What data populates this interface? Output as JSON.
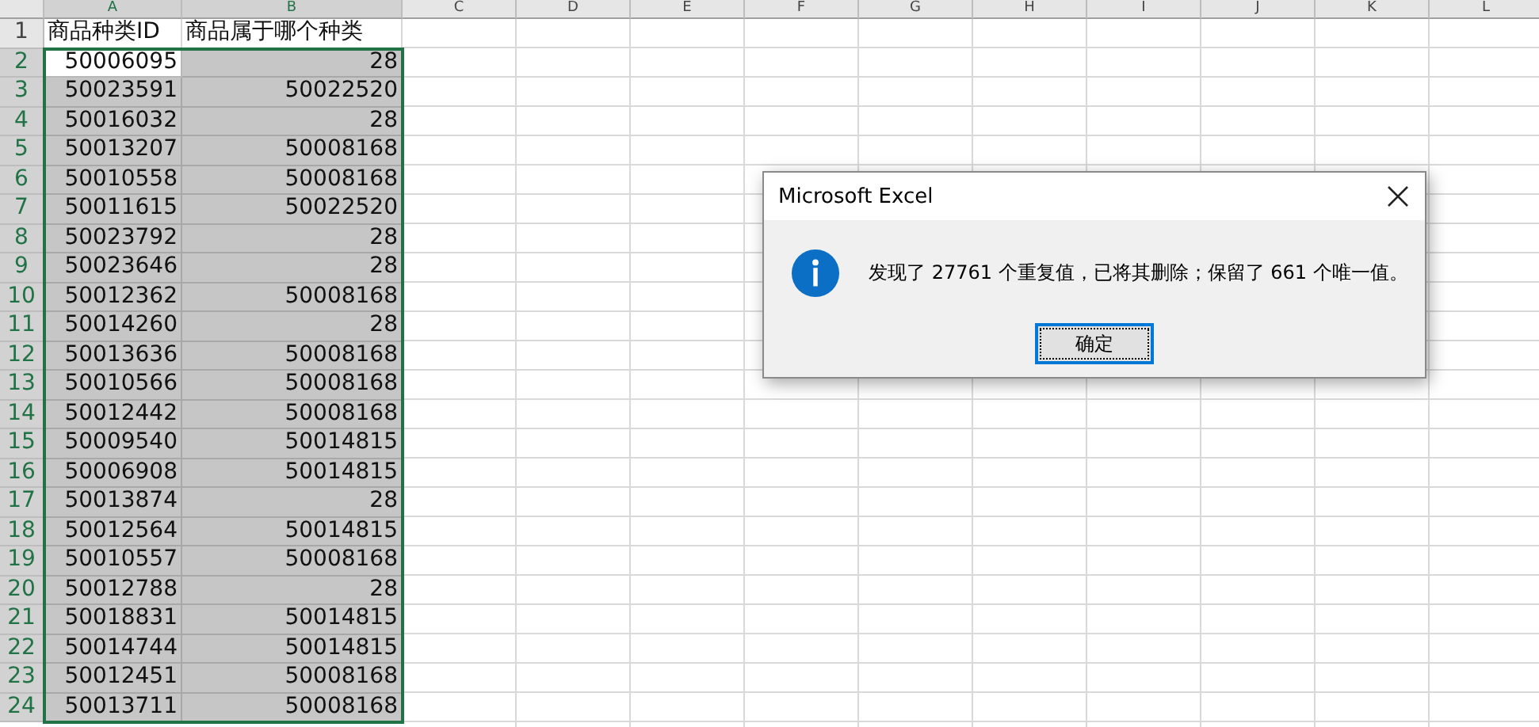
{
  "column_headers": [
    {
      "label": "A",
      "selected": true
    },
    {
      "label": "B",
      "selected": true
    },
    {
      "label": "C",
      "selected": false
    },
    {
      "label": "D",
      "selected": false
    },
    {
      "label": "E",
      "selected": false
    },
    {
      "label": "F",
      "selected": false
    },
    {
      "label": "G",
      "selected": false
    },
    {
      "label": "H",
      "selected": false
    },
    {
      "label": "I",
      "selected": false
    },
    {
      "label": "J",
      "selected": false
    },
    {
      "label": "K",
      "selected": false
    },
    {
      "label": "L",
      "selected": false
    }
  ],
  "rows": [
    {
      "number": "1",
      "kind": "header",
      "selected": false,
      "cells": [
        {
          "text": "商品种类ID",
          "selected": false,
          "active": false
        },
        {
          "text": "商品属于哪个种类",
          "selected": false,
          "active": false
        }
      ]
    },
    {
      "number": "2",
      "kind": "data",
      "selected": true,
      "cells": [
        {
          "text": "50006095",
          "selected": true,
          "active": true
        },
        {
          "text": "28",
          "selected": true,
          "active": false
        }
      ]
    },
    {
      "number": "3",
      "kind": "data",
      "selected": true,
      "cells": [
        {
          "text": "50023591",
          "selected": true,
          "active": false
        },
        {
          "text": "50022520",
          "selected": true,
          "active": false
        }
      ]
    },
    {
      "number": "4",
      "kind": "data",
      "selected": true,
      "cells": [
        {
          "text": "50016032",
          "selected": true,
          "active": false
        },
        {
          "text": "28",
          "selected": true,
          "active": false
        }
      ]
    },
    {
      "number": "5",
      "kind": "data",
      "selected": true,
      "cells": [
        {
          "text": "50013207",
          "selected": true,
          "active": false
        },
        {
          "text": "50008168",
          "selected": true,
          "active": false
        }
      ]
    },
    {
      "number": "6",
      "kind": "data",
      "selected": true,
      "cells": [
        {
          "text": "50010558",
          "selected": true,
          "active": false
        },
        {
          "text": "50008168",
          "selected": true,
          "active": false
        }
      ]
    },
    {
      "number": "7",
      "kind": "data",
      "selected": true,
      "cells": [
        {
          "text": "50011615",
          "selected": true,
          "active": false
        },
        {
          "text": "50022520",
          "selected": true,
          "active": false
        }
      ]
    },
    {
      "number": "8",
      "kind": "data",
      "selected": true,
      "cells": [
        {
          "text": "50023792",
          "selected": true,
          "active": false
        },
        {
          "text": "28",
          "selected": true,
          "active": false
        }
      ]
    },
    {
      "number": "9",
      "kind": "data",
      "selected": true,
      "cells": [
        {
          "text": "50023646",
          "selected": true,
          "active": false
        },
        {
          "text": "28",
          "selected": true,
          "active": false
        }
      ]
    },
    {
      "number": "10",
      "kind": "data",
      "selected": true,
      "cells": [
        {
          "text": "50012362",
          "selected": true,
          "active": false
        },
        {
          "text": "50008168",
          "selected": true,
          "active": false
        }
      ]
    },
    {
      "number": "11",
      "kind": "data",
      "selected": true,
      "cells": [
        {
          "text": "50014260",
          "selected": true,
          "active": false
        },
        {
          "text": "28",
          "selected": true,
          "active": false
        }
      ]
    },
    {
      "number": "12",
      "kind": "data",
      "selected": true,
      "cells": [
        {
          "text": "50013636",
          "selected": true,
          "active": false
        },
        {
          "text": "50008168",
          "selected": true,
          "active": false
        }
      ]
    },
    {
      "number": "13",
      "kind": "data",
      "selected": true,
      "cells": [
        {
          "text": "50010566",
          "selected": true,
          "active": false
        },
        {
          "text": "50008168",
          "selected": true,
          "active": false
        }
      ]
    },
    {
      "number": "14",
      "kind": "data",
      "selected": true,
      "cells": [
        {
          "text": "50012442",
          "selected": true,
          "active": false
        },
        {
          "text": "50008168",
          "selected": true,
          "active": false
        }
      ]
    },
    {
      "number": "15",
      "kind": "data",
      "selected": true,
      "cells": [
        {
          "text": "50009540",
          "selected": true,
          "active": false
        },
        {
          "text": "50014815",
          "selected": true,
          "active": false
        }
      ]
    },
    {
      "number": "16",
      "kind": "data",
      "selected": true,
      "cells": [
        {
          "text": "50006908",
          "selected": true,
          "active": false
        },
        {
          "text": "50014815",
          "selected": true,
          "active": false
        }
      ]
    },
    {
      "number": "17",
      "kind": "data",
      "selected": true,
      "cells": [
        {
          "text": "50013874",
          "selected": true,
          "active": false
        },
        {
          "text": "28",
          "selected": true,
          "active": false
        }
      ]
    },
    {
      "number": "18",
      "kind": "data",
      "selected": true,
      "cells": [
        {
          "text": "50012564",
          "selected": true,
          "active": false
        },
        {
          "text": "50014815",
          "selected": true,
          "active": false
        }
      ]
    },
    {
      "number": "19",
      "kind": "data",
      "selected": true,
      "cells": [
        {
          "text": "50010557",
          "selected": true,
          "active": false
        },
        {
          "text": "50008168",
          "selected": true,
          "active": false
        }
      ]
    },
    {
      "number": "20",
      "kind": "data",
      "selected": true,
      "cells": [
        {
          "text": "50012788",
          "selected": true,
          "active": false
        },
        {
          "text": "28",
          "selected": true,
          "active": false
        }
      ]
    },
    {
      "number": "21",
      "kind": "data",
      "selected": true,
      "cells": [
        {
          "text": "50018831",
          "selected": true,
          "active": false
        },
        {
          "text": "50014815",
          "selected": true,
          "active": false
        }
      ]
    },
    {
      "number": "22",
      "kind": "data",
      "selected": true,
      "cells": [
        {
          "text": "50014744",
          "selected": true,
          "active": false
        },
        {
          "text": "50014815",
          "selected": true,
          "active": false
        }
      ]
    },
    {
      "number": "23",
      "kind": "data",
      "selected": true,
      "cells": [
        {
          "text": "50012451",
          "selected": true,
          "active": false
        },
        {
          "text": "50008168",
          "selected": true,
          "active": false
        }
      ]
    },
    {
      "number": "24",
      "kind": "data",
      "selected": true,
      "cells": [
        {
          "text": "50013711",
          "selected": true,
          "active": false
        },
        {
          "text": "50008168",
          "selected": true,
          "active": false
        }
      ]
    }
  ],
  "dialog": {
    "title": "Microsoft Excel",
    "message": "发现了 27761 个重复值，已将其删除；保留了 661 个唯一值。",
    "buttons": [
      {
        "label": "确定",
        "focused": true
      }
    ]
  }
}
